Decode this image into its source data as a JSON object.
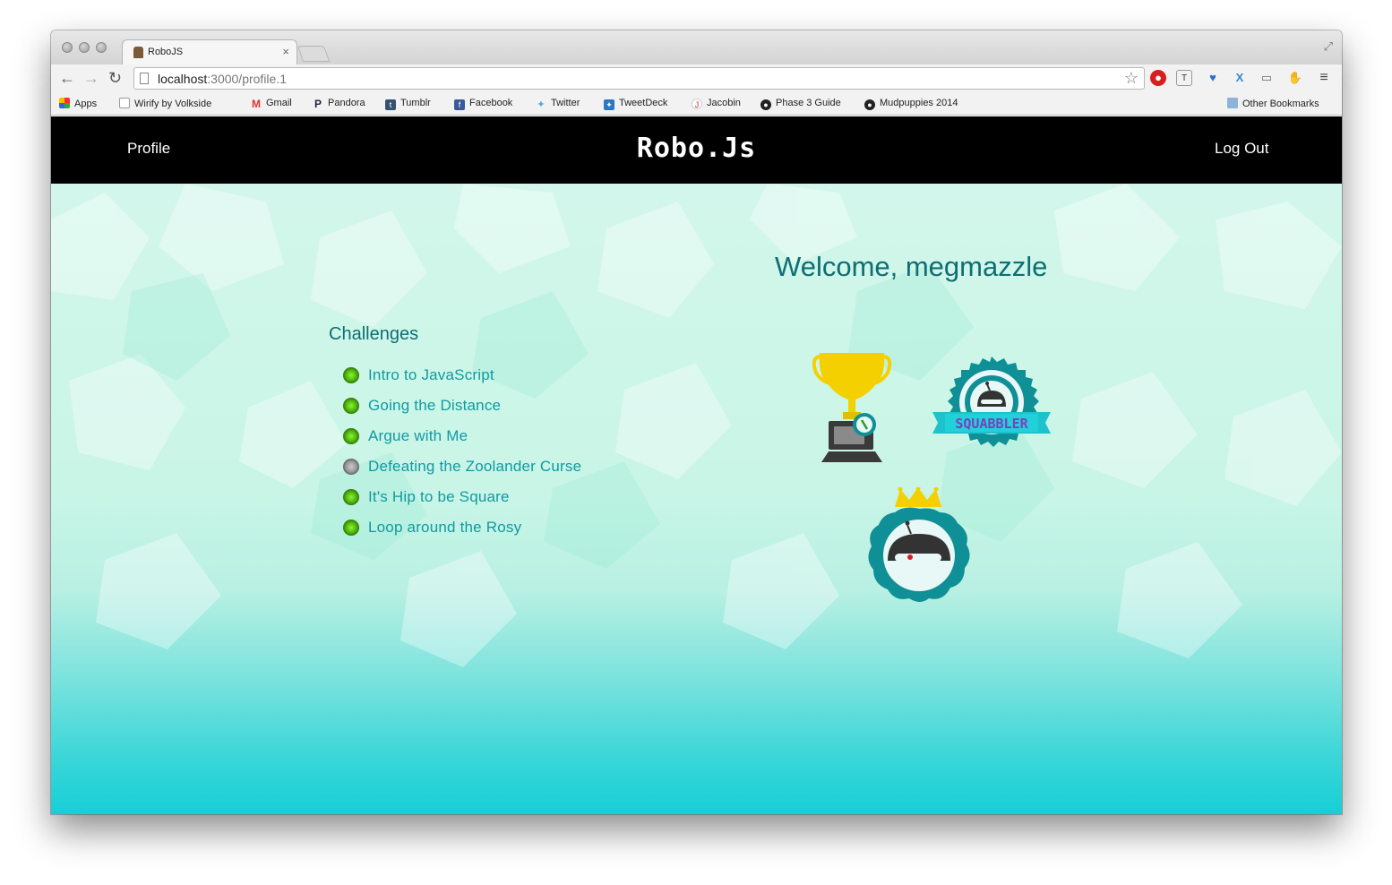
{
  "browser": {
    "tab_title": "RoboJS",
    "url_host": "localhost",
    "url_rest": ":3000/profile.1",
    "bookmarks": [
      {
        "label": "Apps",
        "icon": "apps-grid-icon"
      },
      {
        "label": "Wirify by Volkside",
        "icon": "page-icon"
      },
      {
        "label": "Gmail",
        "icon": "gmail-icon"
      },
      {
        "label": "Pandora",
        "icon": "pandora-icon"
      },
      {
        "label": "Tumblr",
        "icon": "tumblr-icon"
      },
      {
        "label": "Facebook",
        "icon": "facebook-icon"
      },
      {
        "label": "Twitter",
        "icon": "twitter-icon"
      },
      {
        "label": "TweetDeck",
        "icon": "tweetdeck-icon"
      },
      {
        "label": "Jacobin",
        "icon": "jacobin-icon"
      },
      {
        "label": "Phase 3 Guide",
        "icon": "github-icon"
      },
      {
        "label": "Mudpuppies 2014",
        "icon": "github-icon"
      }
    ],
    "other_bookmarks": "Other Bookmarks"
  },
  "navbar": {
    "profile_label": "Profile",
    "brand": "Robo.Js",
    "logout_label": "Log Out"
  },
  "welcome_text": "Welcome, megmazzle",
  "challenges": {
    "title": "Challenges",
    "items": [
      {
        "label": "Intro to JavaScript",
        "completed": true
      },
      {
        "label": "Going the Distance",
        "completed": true
      },
      {
        "label": "Argue with Me",
        "completed": true
      },
      {
        "label": "Defeating the Zoolander Curse",
        "completed": false
      },
      {
        "label": "It's Hip to be Square",
        "completed": true
      },
      {
        "label": "Loop around the Rosy",
        "completed": true
      }
    ]
  },
  "badges": {
    "squabbler_text": "SQUABBLER"
  },
  "colors": {
    "navbar_bg": "#000000",
    "heading": "#0d6e74",
    "link": "#109aa2",
    "badge_teal": "#0f8f96",
    "trophy_gold": "#f5d000"
  }
}
